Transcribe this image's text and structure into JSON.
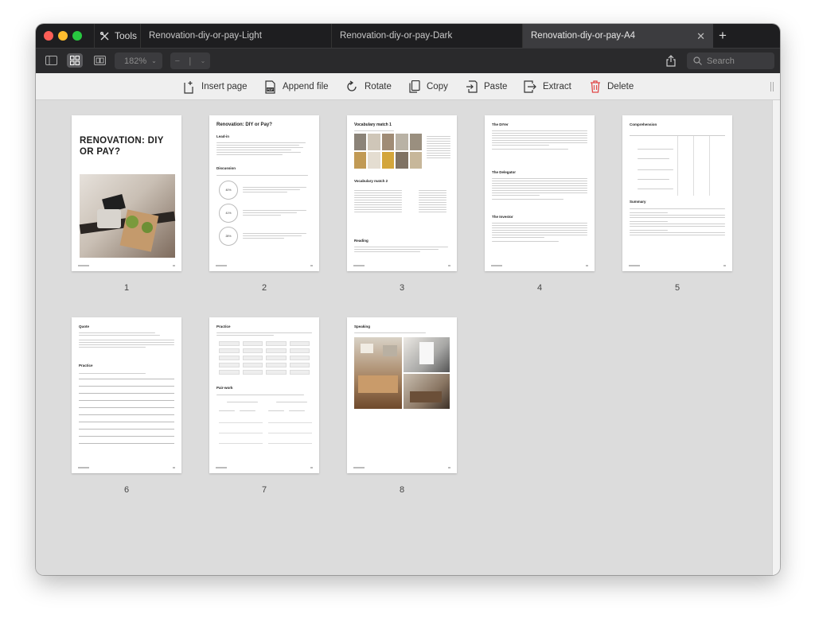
{
  "tabs": {
    "tools_label": "Tools",
    "items": [
      {
        "label": "Renovation-diy-or-pay-Light"
      },
      {
        "label": "Renovation-diy-or-pay-Dark"
      },
      {
        "label": "Renovation-diy-or-pay-A4",
        "active": true
      }
    ]
  },
  "toolbar": {
    "zoom_value": "182%",
    "page_separator": "|",
    "search_placeholder": "Search"
  },
  "actions": [
    {
      "label": "Insert page",
      "icon": "insert-page-icon"
    },
    {
      "label": "Append file",
      "icon": "append-file-icon"
    },
    {
      "label": "Rotate",
      "icon": "rotate-icon"
    },
    {
      "label": "Copy",
      "icon": "copy-icon"
    },
    {
      "label": "Paste",
      "icon": "paste-icon"
    },
    {
      "label": "Extract",
      "icon": "extract-icon"
    },
    {
      "label": "Delete",
      "icon": "delete-icon"
    }
  ],
  "pages": [
    {
      "number": "1",
      "title": "RENOVATION: DIY OR PAY?"
    },
    {
      "number": "2",
      "title": "Renovation: DIY or Pay?",
      "sections": [
        "Lead-in",
        "Discussion"
      ],
      "stats": [
        "40%",
        "41%",
        "28%"
      ]
    },
    {
      "number": "3",
      "title": "Vocabulary match 1",
      "sections": [
        "Vocabulary match 2",
        "Reading"
      ]
    },
    {
      "number": "4",
      "title": "The DIYer",
      "sections": [
        "The Delegator",
        "The Investor"
      ]
    },
    {
      "number": "5",
      "title": "Comprehension",
      "sections": [
        "Summary"
      ]
    },
    {
      "number": "6",
      "title": "Quote",
      "sections": [
        "Practice"
      ]
    },
    {
      "number": "7",
      "title": "Practice",
      "sections": [
        "Pair-work"
      ]
    },
    {
      "number": "8",
      "title": "Speaking"
    }
  ],
  "colors": {
    "close": "#fe5f57",
    "minimize": "#febc2e",
    "zoom": "#28c840",
    "delete": "#e04848",
    "accent": "#3b82f6"
  }
}
